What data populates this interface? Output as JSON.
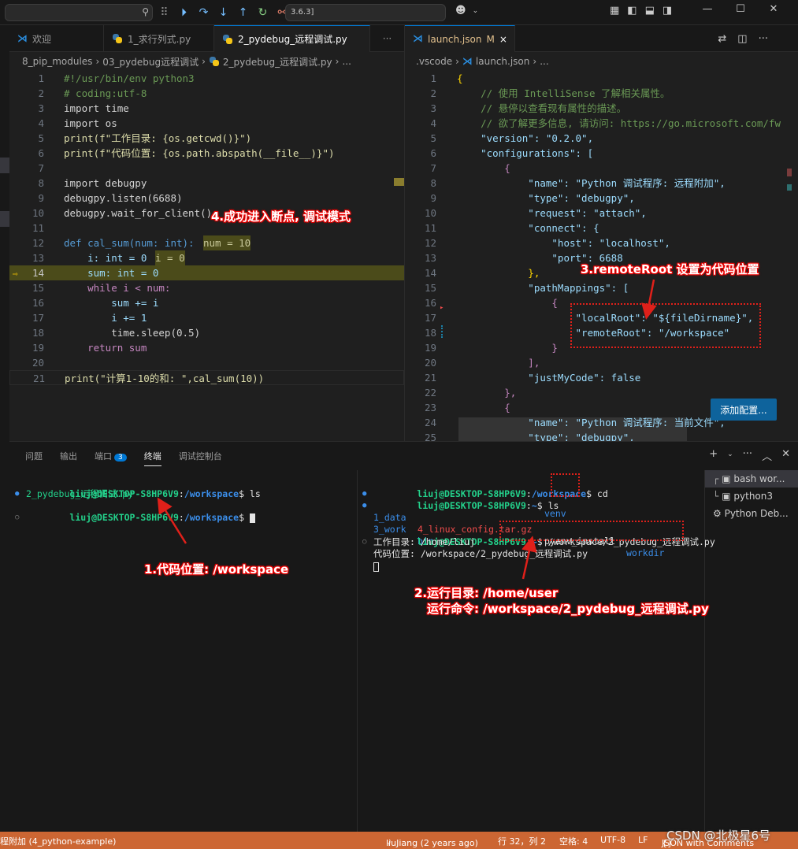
{
  "titlebar": {
    "command_center_text": "3.6.3]",
    "search_placeholder": ""
  },
  "left_editor": {
    "tabs": [
      {
        "label": "欢迎",
        "icon": "vscode-icon"
      },
      {
        "label": "1_求行列式.py",
        "icon": "python-icon"
      },
      {
        "label": "2_pydebug_远程调试.py",
        "icon": "python-icon"
      }
    ],
    "more": "···",
    "breadcrumb": [
      "8_pip_modules",
      "03_pydebug远程调试",
      "2_pydebug_远程调试.py",
      "..."
    ],
    "lines": [
      {
        "n": "1",
        "code": "#!/usr/bin/env python3"
      },
      {
        "n": "2",
        "code": "# coding:utf-8"
      },
      {
        "n": "3",
        "code": "import time"
      },
      {
        "n": "4",
        "code": "import os"
      },
      {
        "n": "5",
        "code": "print(f\"工作目录: {os.getcwd()}\")"
      },
      {
        "n": "6",
        "code": "print(f\"代码位置: {os.path.abspath(__file__)}\")"
      },
      {
        "n": "7",
        "code": ""
      },
      {
        "n": "8",
        "code": "import debugpy"
      },
      {
        "n": "9",
        "code": "debugpy.listen(6688)"
      },
      {
        "n": "10",
        "code": "debugpy.wait_for_client()"
      },
      {
        "n": "11",
        "code": ""
      },
      {
        "n": "12",
        "code": "def cal_sum(num: int):"
      },
      {
        "n": "13",
        "code": "    i: int = 0"
      },
      {
        "n": "14",
        "code": "    sum: int = 0"
      },
      {
        "n": "15",
        "code": "    while i < num:"
      },
      {
        "n": "16",
        "code": "        sum += i"
      },
      {
        "n": "17",
        "code": "        i += 1"
      },
      {
        "n": "18",
        "code": "        time.sleep(0.5)"
      },
      {
        "n": "19",
        "code": "    return sum"
      },
      {
        "n": "20",
        "code": ""
      },
      {
        "n": "21",
        "code": "print(\"计算1-10的和: \",cal_sum(10))"
      }
    ],
    "inline_values": {
      "line12": "num = 10",
      "line13": "i = 0"
    }
  },
  "right_editor": {
    "tab": {
      "label": "launch.json",
      "modified": "M",
      "close": "×"
    },
    "breadcrumb": [
      ".vscode",
      "launch.json",
      "..."
    ],
    "lines": [
      {
        "n": "1",
        "code": "{"
      },
      {
        "n": "2",
        "code": "    // 使用 IntelliSense 了解相关属性。"
      },
      {
        "n": "3",
        "code": "    // 悬停以查看现有属性的描述。"
      },
      {
        "n": "4",
        "code": "    // 欲了解更多信息, 请访问: https://go.microsoft.com/fw"
      },
      {
        "n": "5",
        "code": "    \"version\": \"0.2.0\","
      },
      {
        "n": "6",
        "code": "    \"configurations\": ["
      },
      {
        "n": "7",
        "code": "        {"
      },
      {
        "n": "8",
        "code": "            \"name\": \"Python 调试程序: 远程附加\","
      },
      {
        "n": "9",
        "code": "            \"type\": \"debugpy\","
      },
      {
        "n": "10",
        "code": "            \"request\": \"attach\","
      },
      {
        "n": "11",
        "code": "            \"connect\": {"
      },
      {
        "n": "12",
        "code": "                \"host\": \"localhost\","
      },
      {
        "n": "13",
        "code": "                \"port\": 6688"
      },
      {
        "n": "14",
        "code": "            },"
      },
      {
        "n": "15",
        "code": "            \"pathMappings\": ["
      },
      {
        "n": "16",
        "code": "                {"
      },
      {
        "n": "17",
        "code": "                    \"localRoot\": \"${fileDirname}\","
      },
      {
        "n": "18",
        "code": "                    \"remoteRoot\": \"/workspace\""
      },
      {
        "n": "19",
        "code": "                }"
      },
      {
        "n": "20",
        "code": "            ],"
      },
      {
        "n": "21",
        "code": "            \"justMyCode\": false"
      },
      {
        "n": "22",
        "code": "        },"
      },
      {
        "n": "23",
        "code": "        {"
      },
      {
        "n": "24",
        "code": "            \"name\": \"Python 调试程序: 当前文件\","
      },
      {
        "n": "25",
        "code": "            \"type\": \"debugpy\","
      }
    ],
    "add_config_button": "添加配置..."
  },
  "panel": {
    "tabs": [
      "问题",
      "输出",
      "端口",
      "终端",
      "调试控制台"
    ],
    "ports_count": "3",
    "active_tab": "终端",
    "terminal_left": {
      "prompt_user": "liuj@DESKTOP-S8HP6V9",
      "lines": [
        {
          "path": "/workspace",
          "cmd": "ls"
        },
        {
          "output": "2_pydebug_远程调试.py"
        },
        {
          "path": "/workspace",
          "cmd": ""
        }
      ]
    },
    "terminal_right": {
      "prompt_user": "liuj@DESKTOP-S8HP6V9",
      "line1": {
        "path": "/workspace",
        "cmd": "cd"
      },
      "line2": {
        "path": "~",
        "cmd": "ls"
      },
      "ls_row1": [
        "1_data",
        "4_linux_config.tar.gz",
        "pyenv_install",
        "workdir"
      ],
      "ls_row2": [
        "3_work",
        "bin",
        "venv"
      ],
      "line3": {
        "path": "~",
        "cmd": "/workspace/2_pydebug_远程调试.py"
      },
      "out1": "工作目录: /home/liuj",
      "out2": "代码位置: /workspace/2_pydebug_远程调试.py"
    },
    "terminal_list": [
      "bash wor...",
      "python3",
      "Python Deb..."
    ]
  },
  "annotations": {
    "a1": "1.代码位置: /workspace",
    "a2_line1": "2.运行目录: /home/user",
    "a2_line2": "运行命令: /workspace/2_pydebug_远程调试.py",
    "a3": "3.remoteRoot 设置为代码位置",
    "a4": "4.成功进入断点, 调试模式",
    "annotation_color": "#e0201a"
  },
  "statusbar": {
    "left": "程附加 (4_python-example)",
    "blame": "liuJiang (2 years ago)",
    "position": "行 32，列 2",
    "spaces": "空格: 4",
    "encoding": "UTF-8",
    "eol": "LF",
    "language": "JSON with Comments",
    "watermark": "CSDN @北极星6号",
    "background_color": "#cc6633"
  }
}
